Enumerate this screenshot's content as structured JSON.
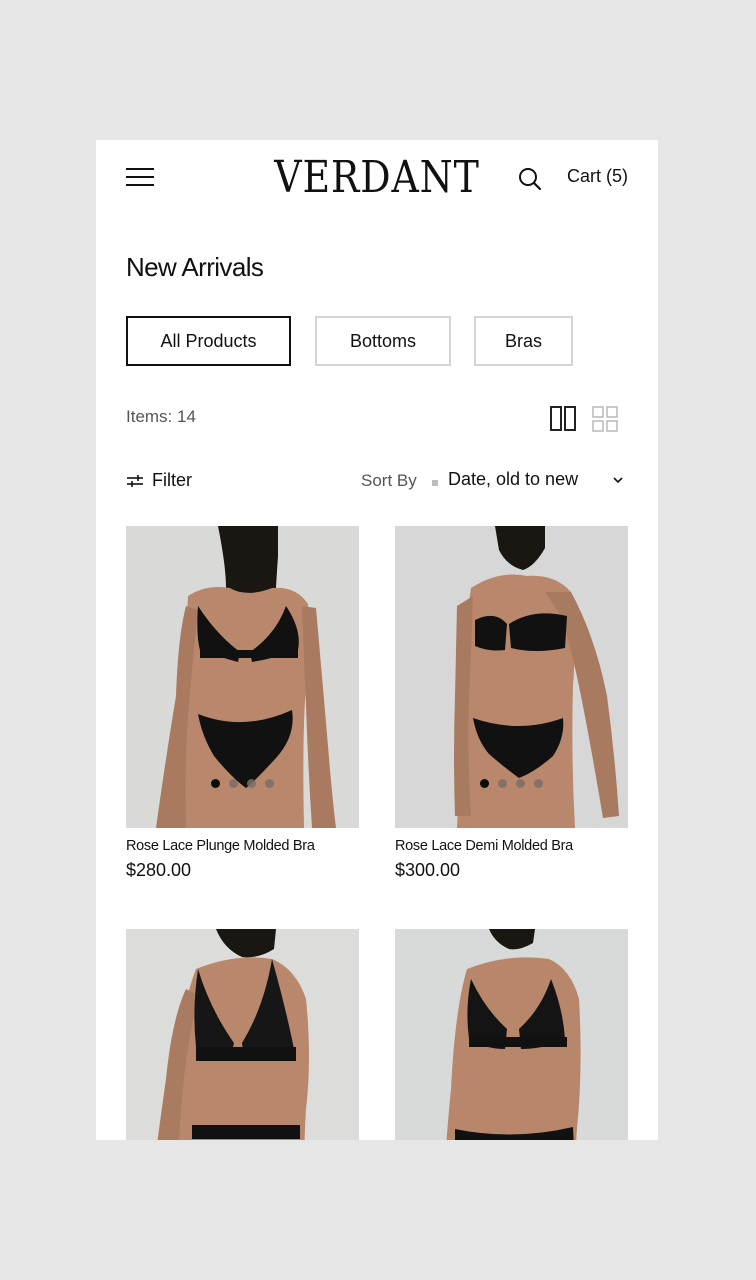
{
  "header": {
    "logo": "VERDANT",
    "cart_label": "Cart",
    "cart_count": "(5)"
  },
  "page": {
    "title": "New Arrivals",
    "categories": [
      {
        "label": "All Products",
        "active": true
      },
      {
        "label": "Bottoms",
        "active": false
      },
      {
        "label": "Bras",
        "active": false
      }
    ],
    "items_count": "Items: 14"
  },
  "toolbar": {
    "filter_label": "Filter",
    "sort_label": "Sort By",
    "sort_value": "Date, old to new"
  },
  "products": [
    {
      "name": "Rose Lace Plunge Molded Bra",
      "price": "$280.00"
    },
    {
      "name": "Rose Lace Demi Molded Bra",
      "price": "$300.00"
    },
    {
      "name": "",
      "price": ""
    },
    {
      "name": "",
      "price": ""
    }
  ],
  "icons": [
    "hamburger-menu-icon",
    "search-icon",
    "grid-2-column-icon",
    "grid-4-column-icon",
    "filter-sliders-icon",
    "chevron-down-icon"
  ],
  "colors": {
    "background": "#e6e6e6",
    "surface": "#ffffff",
    "text": "#111111",
    "muted_text": "#555555",
    "inactive_border": "#d4d4d4",
    "active_border": "#111111"
  }
}
